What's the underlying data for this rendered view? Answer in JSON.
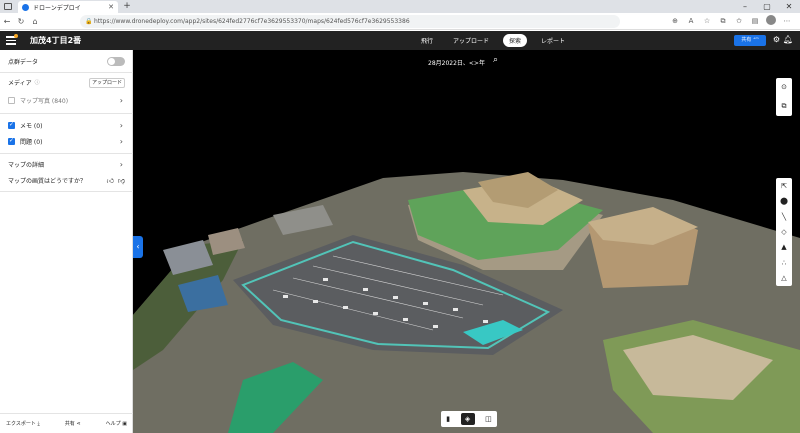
{
  "browser": {
    "tab_title": "ドローンデプロイ",
    "url": "https://www.dronedeploy.com/app2/sites/624fed2776cf7e3629553370/maps/624fed576cf7e3629553386"
  },
  "header": {
    "title": "加茂4丁目2番",
    "modes": [
      "飛行",
      "アップロード",
      "探索",
      "レポート"
    ],
    "active_mode": "探索",
    "share_label": "共有 ⁺ᵐ"
  },
  "sidebar": {
    "pointcloud_label": "点群データ",
    "media_label": "メディア",
    "upload_button": "アップロード",
    "map_photos": "マップ写真 (840)",
    "memo": "メモ (0)",
    "issues": "問題 (0)",
    "map_details": "マップの詳細",
    "map_quality": "マップの画質はどうですか？",
    "footer": {
      "export": "エクスポート",
      "share": "共有",
      "help": "ヘルプ"
    }
  },
  "map": {
    "date": "28月2022日、<>年"
  },
  "colors": {
    "accent": "#1a73e8",
    "header_bg": "#222222",
    "roof_green": "#5fa35a"
  }
}
